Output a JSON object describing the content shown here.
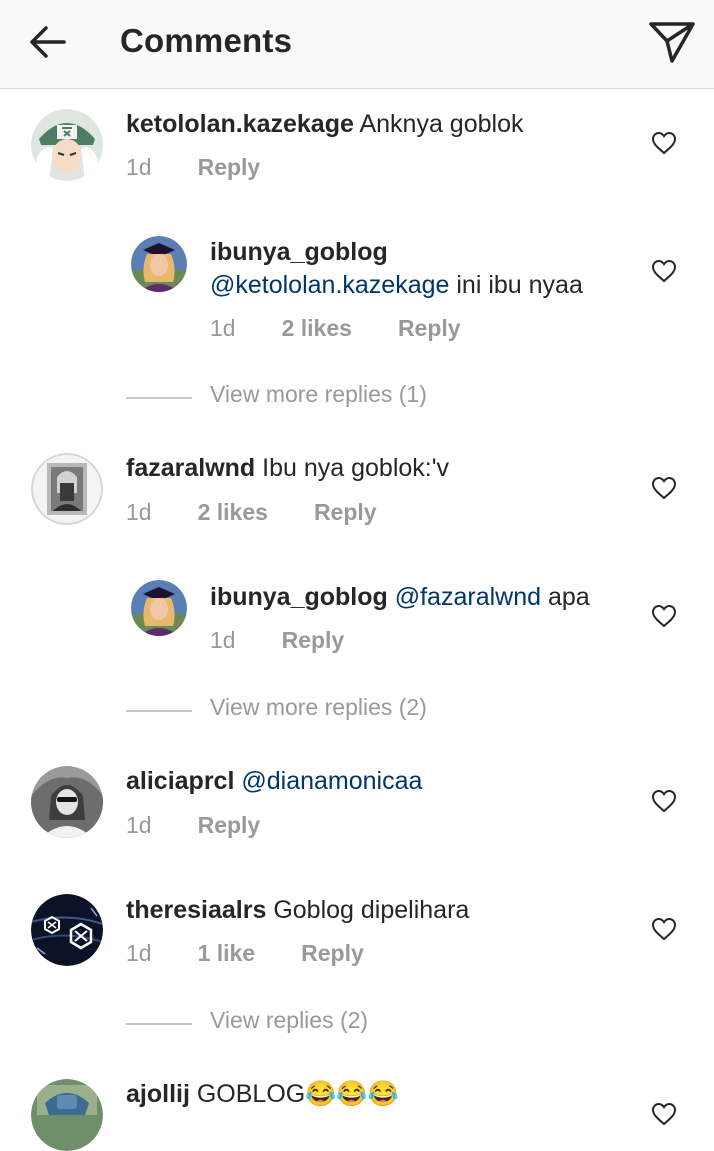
{
  "header": {
    "title": "Comments"
  },
  "comments": [
    {
      "username": "ketololan.kazekage",
      "text": "Anknya goblok",
      "time": "1d",
      "reply": "Reply"
    },
    {
      "username": "ibunya_goblog",
      "mention": "@ketololan.kazekage",
      "text": "ini ibu nyaa",
      "time": "1d",
      "likes": "2 likes",
      "reply": "Reply"
    },
    {
      "more": "View more replies (1)"
    },
    {
      "username": "fazaralwnd",
      "text": "Ibu nya goblok:'v",
      "time": "1d",
      "likes": "2 likes",
      "reply": "Reply"
    },
    {
      "username": "ibunya_goblog",
      "mention": "@fazaralwnd",
      "text": "apa",
      "time": "1d",
      "reply": "Reply"
    },
    {
      "more": "View more replies (2)"
    },
    {
      "username": "aliciaprcl",
      "mention": "@dianamonicaa",
      "time": "1d",
      "reply": "Reply"
    },
    {
      "username": "theresiaalrs",
      "text": "Goblog dipelihara",
      "time": "1d",
      "likes": "1 like",
      "reply": "Reply"
    },
    {
      "more": "View replies (2)"
    },
    {
      "username": "ajollij",
      "text": "GOBLOG😂😂😂"
    }
  ],
  "icons": {
    "back": "arrow-left-icon",
    "send": "paper-plane-icon",
    "like": "heart-outline-icon"
  },
  "colors": {
    "header_bg": "#fafafa",
    "mention": "#003569",
    "meta": "#999999",
    "text": "#262626"
  }
}
